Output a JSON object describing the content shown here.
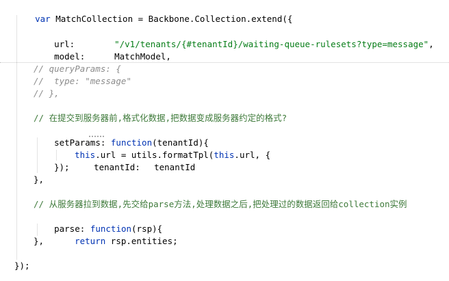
{
  "code": {
    "l1_kw": "var",
    "l1_rest": " MatchCollection = Backbone.Collection.extend({",
    "l2_key": "url:",
    "l2_val": "\"/v1/tenants/{#tenantId}/waiting-queue-rulesets?type=message\"",
    "l2_tail": ",",
    "l3_key": "model:",
    "l3_val": "MatchModel,",
    "l4": "// queryParams: {",
    "l5": "//  type: \"message\"",
    "l6": "// },",
    "l7": "// 在提交到服务器前,格式化数据,把数据变成服务器约定的格式?",
    "l8_key": "setParams",
    "l8_colon": ": ",
    "l8_kw": "function",
    "l8_rest": "(tenantId){",
    "l9_kw1": "this",
    "l9_mid": ".url = utils.formatTpl(",
    "l9_kw2": "this",
    "l9_end": ".url, {",
    "l10_key": "tenantId:",
    "l10_val": "tenantId",
    "l11": "});",
    "l12": "},",
    "l13": "// 从服务器拉到数据,先交给parse方法,处理数据之后,把处理过的数据返回给collection实例",
    "l14_key": "parse",
    "l14_colon": ": ",
    "l14_kw": "function",
    "l14_rest": "(rsp){",
    "l15_kw": "return",
    "l15_rest": " rsp.entities;",
    "l16": "},",
    "l17": "});"
  }
}
